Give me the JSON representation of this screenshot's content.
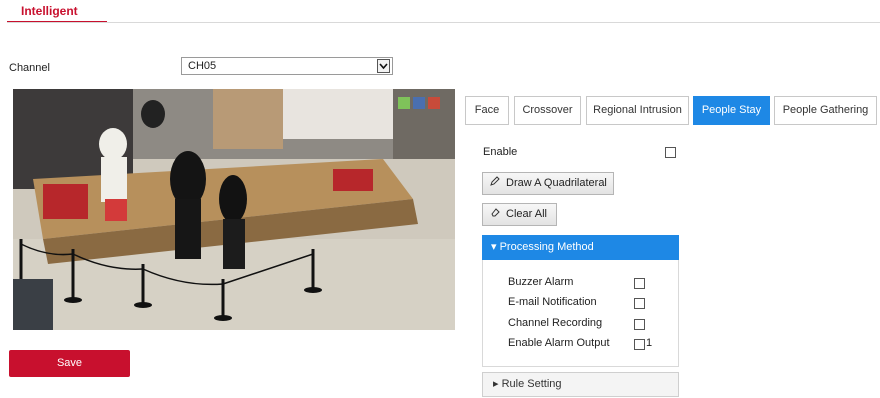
{
  "top_tab": {
    "label": "Intelligent"
  },
  "channel": {
    "label": "Channel",
    "selected": "CH05"
  },
  "save": {
    "label": "Save"
  },
  "tabs": [
    {
      "label": "Face"
    },
    {
      "label": "Crossover"
    },
    {
      "label": "Regional Intrusion"
    },
    {
      "label": "People Stay"
    },
    {
      "label": "People Gathering"
    }
  ],
  "active_tab": "People Stay",
  "enable": {
    "label": "Enable",
    "checked": false
  },
  "buttons": {
    "draw": {
      "label": "Draw A Quadrilateral",
      "icon": "pencil-icon"
    },
    "clear": {
      "label": "Clear All",
      "icon": "eraser-icon"
    }
  },
  "processing": {
    "header": "Processing Method",
    "expanded": true,
    "options": [
      {
        "label": "Buzzer Alarm",
        "checked": false
      },
      {
        "label": "E-mail Notification",
        "checked": false
      },
      {
        "label": "Channel Recording",
        "checked": false
      },
      {
        "label": "Enable Alarm Output",
        "checked": false
      }
    ],
    "alarm_output_number": "1"
  },
  "rule_setting": {
    "label": "Rule Setting",
    "expanded": false
  },
  "colors": {
    "accent_red": "#c8102e",
    "active_blue": "#1e88e5"
  }
}
